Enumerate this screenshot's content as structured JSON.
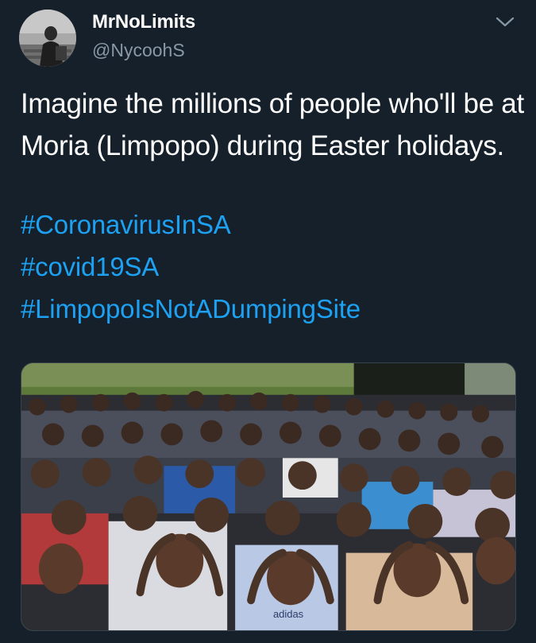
{
  "user": {
    "display_name": "MrNoLimits",
    "handle": "@NycoohS"
  },
  "tweet": {
    "text": "Imagine the millions of people who'll be at Moria (Limpopo) during Easter holidays.",
    "hashtags": [
      "#CoronavirusInSA",
      "#covid19SA",
      "#LimpopoIsNotADumpingSite"
    ]
  },
  "media": {
    "shirt_brand_text": "adidas"
  },
  "icons": {
    "menu": "chevron-down-icon"
  },
  "colors": {
    "background": "#15202b",
    "text": "#ffffff",
    "secondary_text": "#8899a6",
    "link": "#1da1f2"
  }
}
